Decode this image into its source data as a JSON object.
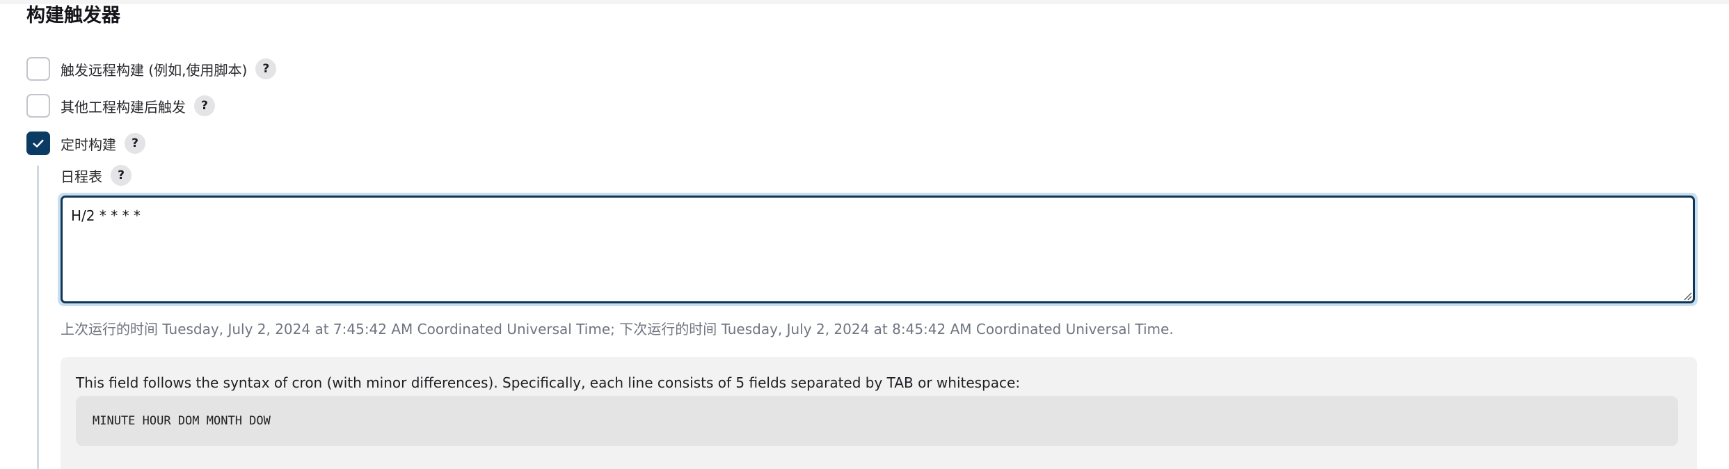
{
  "section": {
    "title": "构建触发器"
  },
  "options": [
    {
      "label": "触发远程构建 (例如,使用脚本)",
      "checked": false,
      "help": "?"
    },
    {
      "label": "其他工程构建后触发",
      "checked": false,
      "help": "?"
    },
    {
      "label": "定时构建",
      "checked": true,
      "help": "?"
    }
  ],
  "schedule": {
    "label": "日程表",
    "help": "?",
    "value": "H/2 * * * *",
    "run_info": "上次运行的时间 Tuesday, July 2, 2024 at 7:45:42 AM Coordinated Universal Time; 下次运行的时间 Tuesday, July 2, 2024 at 8:45:42 AM Coordinated Universal Time."
  },
  "help_panel": {
    "text": "This field follows the syntax of cron (with minor differences). Specifically, each line consists of 5 fields separated by TAB or whitespace:",
    "code": "MINUTE HOUR DOM MONTH DOW"
  },
  "colors": {
    "checked": "#0b3a63",
    "focus_border": "#0e3556",
    "focus_ring": "#c9dff0",
    "muted_text": "#6f7480"
  }
}
